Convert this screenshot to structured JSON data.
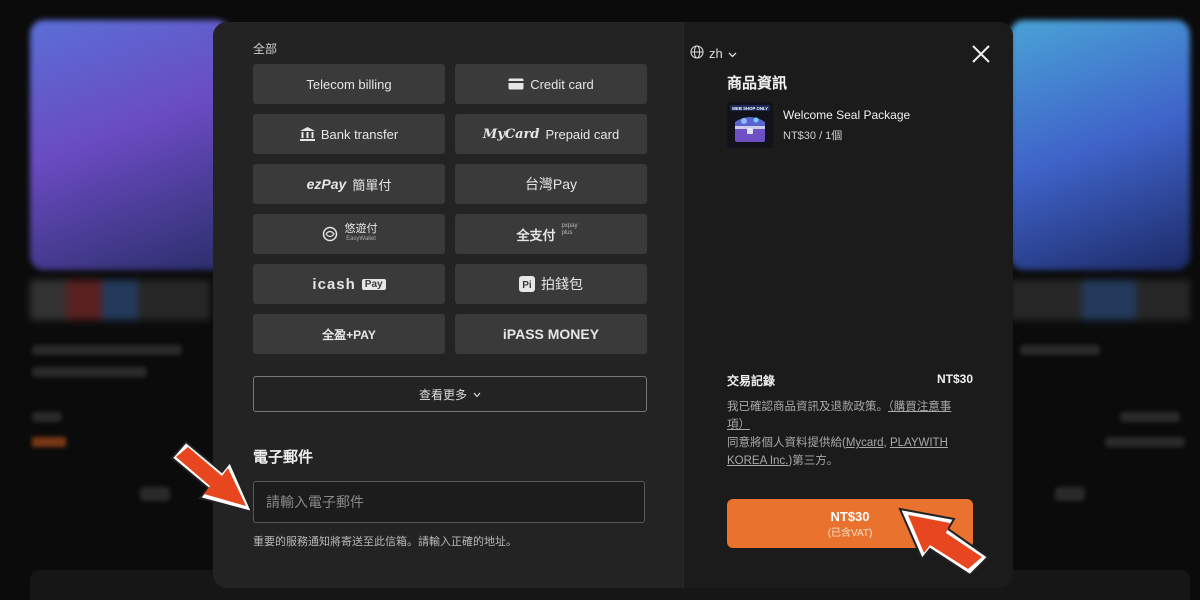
{
  "left": {
    "category_label": "全部",
    "methods": [
      {
        "label": "Telecom billing",
        "icon": ""
      },
      {
        "label": "Credit card",
        "icon": "credit-card-icon"
      },
      {
        "label": "Bank transfer",
        "icon": "bank-icon"
      },
      {
        "label": "Prepaid card",
        "icon": "mycard-logo-icon",
        "prefix": "MyCard"
      },
      {
        "label": "簡單付",
        "icon": "ezpay-logo-icon",
        "prefix": "ezPay"
      },
      {
        "label": "台灣Pay",
        "icon": ""
      },
      {
        "label": "悠遊付",
        "icon": "easywallet-icon",
        "sub": "EasyWallet"
      },
      {
        "label": "全支付",
        "icon": "pxpay-icon",
        "sub": "pxpay plus"
      },
      {
        "label": "icash",
        "icon": "icash-logo-icon",
        "suffix": "Pay"
      },
      {
        "label": "拍錢包",
        "icon": "pi-wallet-icon"
      },
      {
        "label": "全盈+PAY",
        "icon": "plus-pay-icon"
      },
      {
        "label": "iPASS MONEY",
        "icon": "ipass-money-icon"
      }
    ],
    "view_more": "查看更多",
    "email_label": "電子郵件",
    "email_placeholder": "請輸入電子郵件",
    "email_note": "重要的服務通知將寄送至此信箱。請輸入正確的地址。"
  },
  "right": {
    "lang": "zh",
    "product_title": "商品資訊",
    "product_name": "Welcome Seal Package",
    "product_price": "NT$30 / 1個",
    "thumb_badge": "WEB SHOP ONLY",
    "txn_label": "交易記錄",
    "txn_amount": "NT$30",
    "terms_1": "我已確認商品資訊及退款政策。",
    "terms_link_1": "（購買注意事項）",
    "terms_2_pre": "同意將個人資料提供給(",
    "terms_link_mycard": "Mycard",
    "terms_2_mid": ", ",
    "terms_link_pw": "PLAYWITH KOREA Inc.",
    "terms_2_post": ")第三方。",
    "checkout_amount": "NT$30",
    "checkout_vat": "(已含VAT)"
  },
  "colors": {
    "accent": "#e8722e",
    "arrow": "#e8461e"
  }
}
